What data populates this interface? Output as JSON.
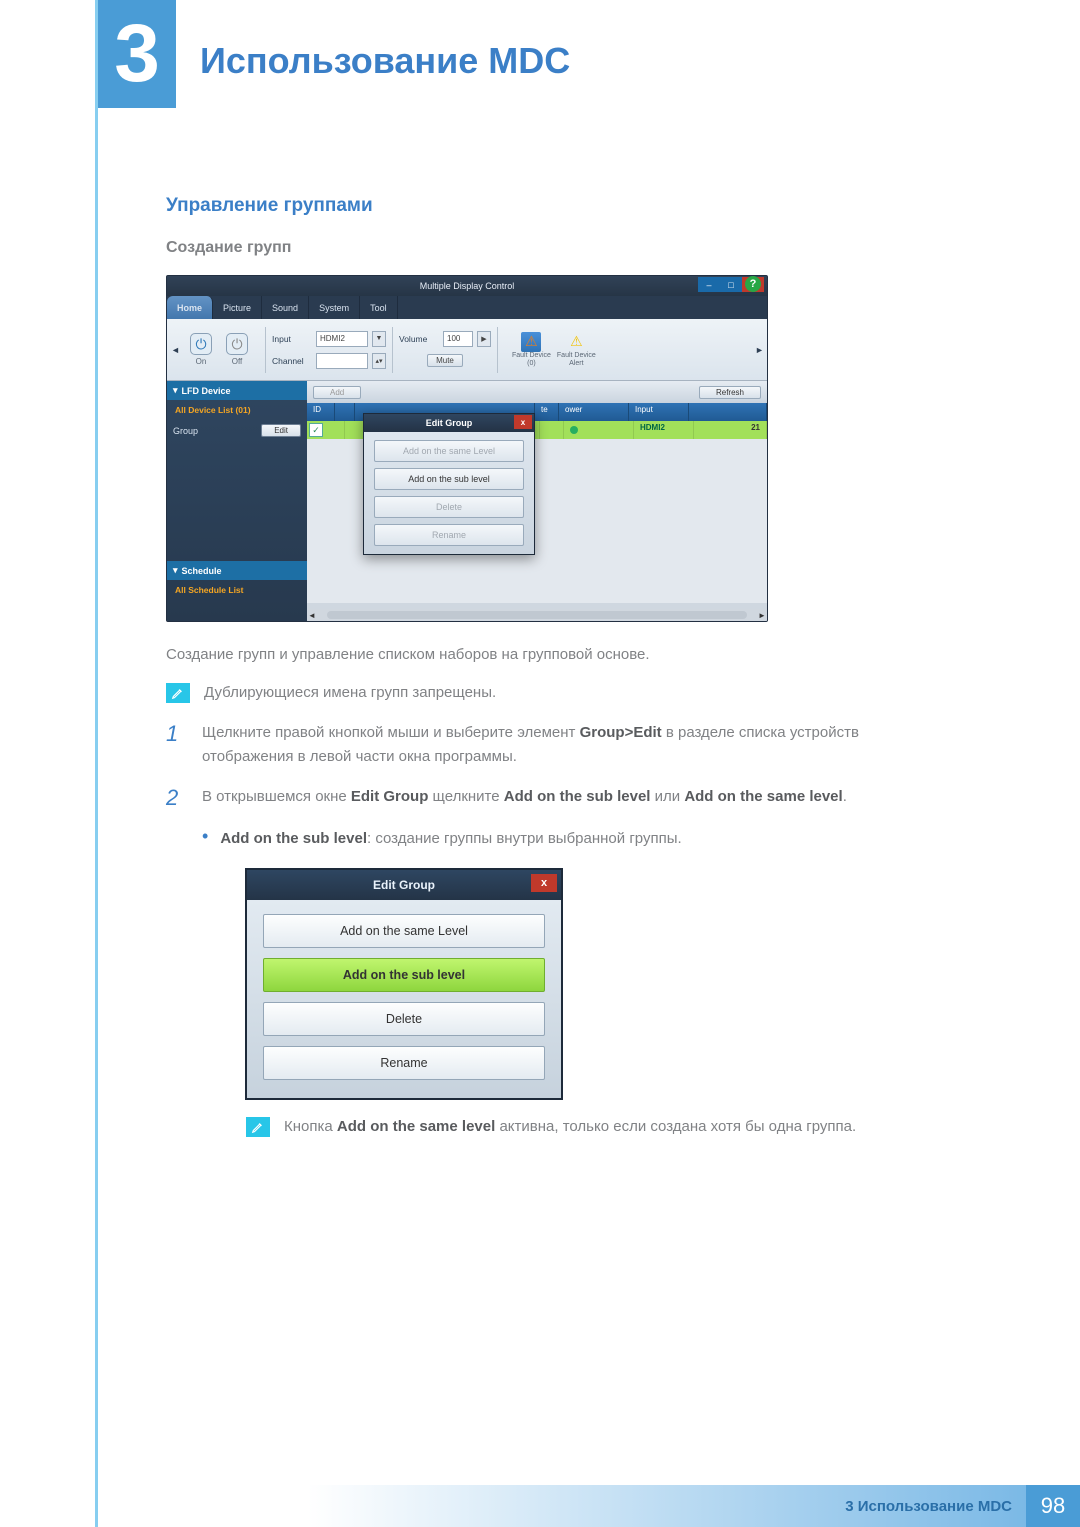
{
  "chapter": {
    "number": "3",
    "title": "Использование MDC"
  },
  "section": {
    "h2": "Управление группами",
    "h3": "Создание групп"
  },
  "app": {
    "title": "Multiple Display Control",
    "help_glyph": "?",
    "win": {
      "min": "–",
      "max": "□",
      "close": "x"
    },
    "tabs": [
      "Home",
      "Picture",
      "Sound",
      "System",
      "Tool"
    ],
    "toolbar": {
      "on_label": "On",
      "off_label": "Off",
      "input_label": "Input",
      "input_value": "HDMI2",
      "channel_label": "Channel",
      "volume_label": "Volume",
      "volume_value": "100",
      "mute_label": "Mute",
      "fault1_label": "Fault Device",
      "fault1_count": "(0)",
      "fault2_label": "Fault Device",
      "fault2_sub": "Alert"
    },
    "side": {
      "lfd_header": "LFD Device",
      "all_device": "All Device List (01)",
      "group_label": "Group",
      "edit_btn": "Edit",
      "schedule_header": "Schedule",
      "all_schedule": "All Schedule List"
    },
    "grid": {
      "add_btn": "Add",
      "refresh_btn": "Refresh",
      "headers": {
        "id": "ID",
        "pwr": "ower",
        "input": "Input",
        "te": "te"
      },
      "row": {
        "input": "HDMI2",
        "num": "21"
      }
    },
    "popup": {
      "title": "Edit Group",
      "btn1": "Add on the same Level",
      "btn2": "Add on the sub level",
      "btn3": "Delete",
      "btn4": "Rename"
    }
  },
  "body_text": "Создание групп и управление списком наборов на групповой основе.",
  "note1": "Дублирующиеся имена групп запрещены.",
  "step1": {
    "a": "Щелкните правой кнопкой мыши и выберите элемент ",
    "b": "Group>Edit",
    "c": " в разделе списка устройств отображения в левой части окна программы."
  },
  "step2": {
    "a": "В открывшемся окне ",
    "b": "Edit Group",
    "c": " щелкните ",
    "d": "Add on the sub level",
    "e": " или ",
    "f": "Add on the same level",
    "g": "."
  },
  "sub_bullet": {
    "b": "Add on the sub level",
    "c": ": создание группы внутри выбранной группы."
  },
  "dialog": {
    "title": "Edit Group",
    "btn1": "Add on the same Level",
    "btn2": "Add on the sub level",
    "btn3": "Delete",
    "btn4": "Rename"
  },
  "note2": {
    "a": "Кнопка ",
    "b": "Add on the same level",
    "c": " активна, только если создана хотя бы одна группа."
  },
  "footer": {
    "text": "3 Использование MDC",
    "page": "98"
  }
}
